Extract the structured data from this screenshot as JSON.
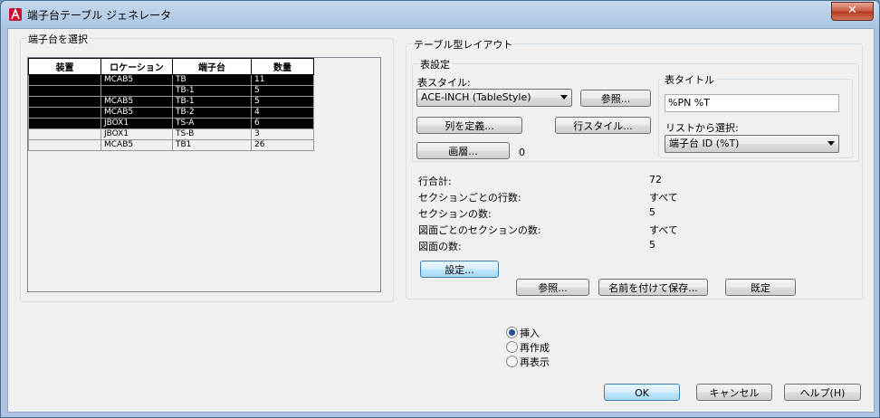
{
  "window": {
    "title": "端子台テーブル ジェネレータ",
    "close": "✕"
  },
  "left": {
    "group_label": "端子台を選択",
    "columns": [
      "装置",
      "ロケーション",
      "端子台",
      "数量"
    ],
    "rows": [
      {
        "c": [
          "",
          "MCAB5",
          "TB",
          "11"
        ],
        "selected": true
      },
      {
        "c": [
          "",
          "",
          "TB-1",
          "5"
        ],
        "selected": true
      },
      {
        "c": [
          "",
          "MCAB5",
          "TB-1",
          "5"
        ],
        "selected": true
      },
      {
        "c": [
          "",
          "MCAB5",
          "TB-2",
          "4"
        ],
        "selected": true
      },
      {
        "c": [
          "",
          "JBOX1",
          "TS-A",
          "6"
        ],
        "selected": true
      },
      {
        "c": [
          "",
          "JBOX1",
          "TS-B",
          "3"
        ],
        "selected": false
      },
      {
        "c": [
          "",
          "MCAB5",
          "TB1",
          "26"
        ],
        "selected": false
      }
    ]
  },
  "right": {
    "group_label": "テーブル型レイアウト",
    "table_settings": {
      "label": "表設定",
      "style_label": "表スタイル:",
      "style_value": "ACE-INCH (TableStyle)",
      "browse_btn": "参照...",
      "define_cols_btn": "列を定義...",
      "row_style_btn": "行スタイル...",
      "layer_btn": "画層...",
      "layer_value": "0"
    },
    "table_title": {
      "label": "表タイトル",
      "value": "%PN %T",
      "list_label": "リストから選択:",
      "list_value": "端子台 ID (%T)"
    },
    "stats": [
      {
        "k": "行合計:",
        "v": "72"
      },
      {
        "k": "セクションごとの行数:",
        "v": "すべて"
      },
      {
        "k": "セクションの数:",
        "v": "5"
      },
      {
        "k": "図面ごとのセクションの数:",
        "v": "すべて"
      },
      {
        "k": "図面の数:",
        "v": "5"
      }
    ],
    "settings_btn": "設定...",
    "browse_btn2": "参照...",
    "save_as_btn": "名前を付けて保存...",
    "default_btn": "既定"
  },
  "radios": [
    {
      "label": "挿入",
      "checked": true
    },
    {
      "label": "再作成",
      "checked": false
    },
    {
      "label": "再表示",
      "checked": false
    }
  ],
  "footer": {
    "ok": "OK",
    "cancel": "キャンセル",
    "help": "ヘルプ(H)"
  }
}
